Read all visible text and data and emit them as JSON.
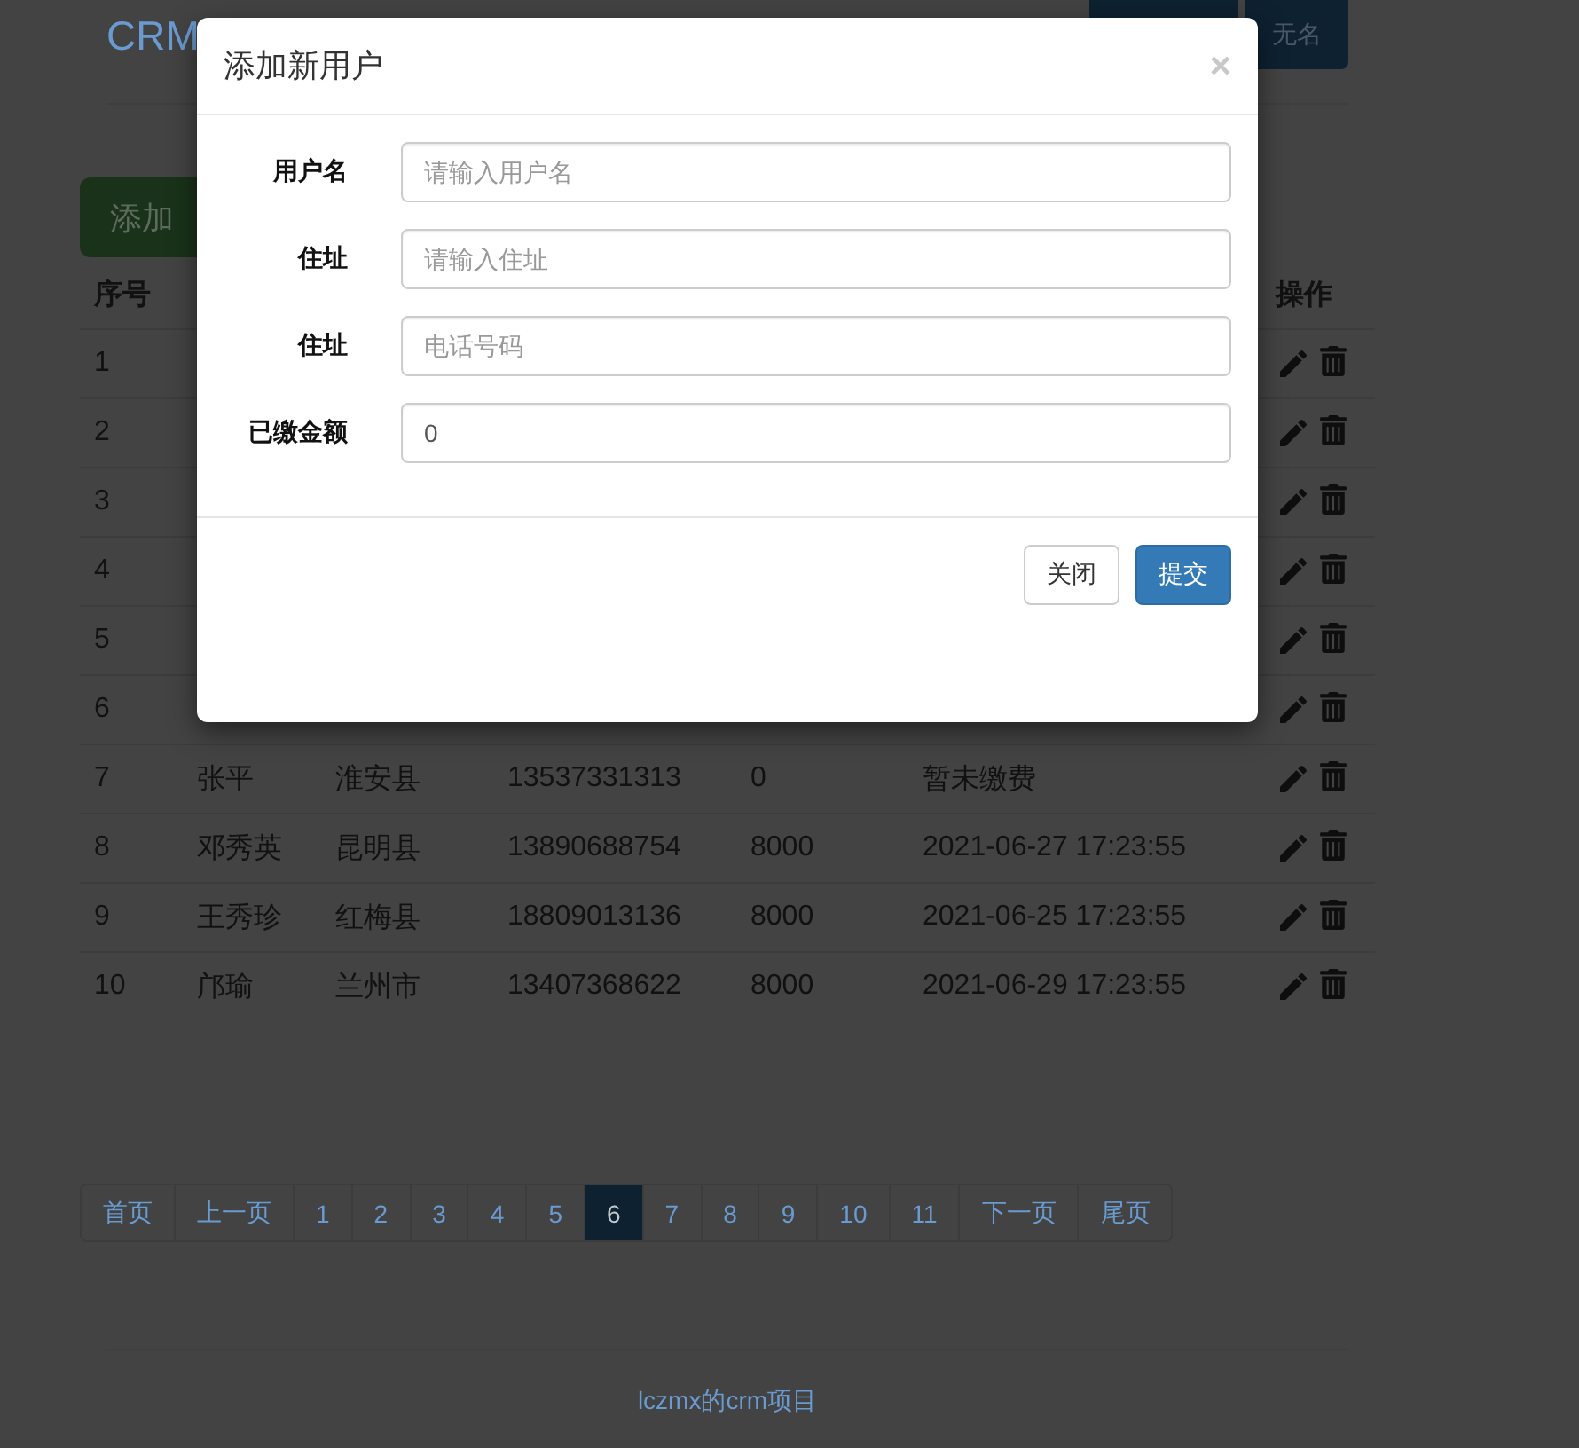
{
  "header": {
    "title": "CRM",
    "user_button": "无名"
  },
  "add_button": "添加",
  "table": {
    "columns": [
      "序号",
      "操作"
    ],
    "rows": [
      {
        "id": "1"
      },
      {
        "id": "2"
      },
      {
        "id": "3"
      },
      {
        "id": "4"
      },
      {
        "id": "5"
      },
      {
        "id": "6"
      },
      {
        "id": "7",
        "name": "张平",
        "address": "淮安县",
        "phone": "13537331313",
        "paid": "0",
        "time": "暂未缴费"
      },
      {
        "id": "8",
        "name": "邓秀英",
        "address": "昆明县",
        "phone": "13890688754",
        "paid": "8000",
        "time": "2021-06-27 17:23:55"
      },
      {
        "id": "9",
        "name": "王秀珍",
        "address": "红梅县",
        "phone": "18809013136",
        "paid": "8000",
        "time": "2021-06-25 17:23:55"
      },
      {
        "id": "10",
        "name": "邝瑜",
        "address": "兰州市",
        "phone": "13407368622",
        "paid": "8000",
        "time": "2021-06-29 17:23:55"
      }
    ]
  },
  "pagination": [
    {
      "label": "首页",
      "selected": false
    },
    {
      "label": "上一页",
      "selected": false
    },
    {
      "label": "1",
      "selected": false
    },
    {
      "label": "2",
      "selected": false
    },
    {
      "label": "3",
      "selected": false
    },
    {
      "label": "4",
      "selected": false
    },
    {
      "label": "5",
      "selected": false
    },
    {
      "label": "6",
      "selected": true
    },
    {
      "label": "7",
      "selected": false
    },
    {
      "label": "8",
      "selected": false
    },
    {
      "label": "9",
      "selected": false
    },
    {
      "label": "10",
      "selected": false
    },
    {
      "label": "11",
      "selected": false
    },
    {
      "label": "下一页",
      "selected": false
    },
    {
      "label": "尾页",
      "selected": false
    }
  ],
  "footer": "lczmx的crm项目",
  "modal": {
    "title": "添加新用户",
    "close": "×",
    "fields": [
      {
        "label": "用户名",
        "placeholder": "请输入用户名"
      },
      {
        "label": "住址",
        "placeholder": "请输入住址"
      },
      {
        "label": "住址",
        "placeholder": "电话号码"
      },
      {
        "label": "已缴金额",
        "value": "0"
      }
    ],
    "buttons": [
      {
        "label": "关闭",
        "kind": "default"
      },
      {
        "label": "提交",
        "kind": "primary"
      }
    ]
  }
}
